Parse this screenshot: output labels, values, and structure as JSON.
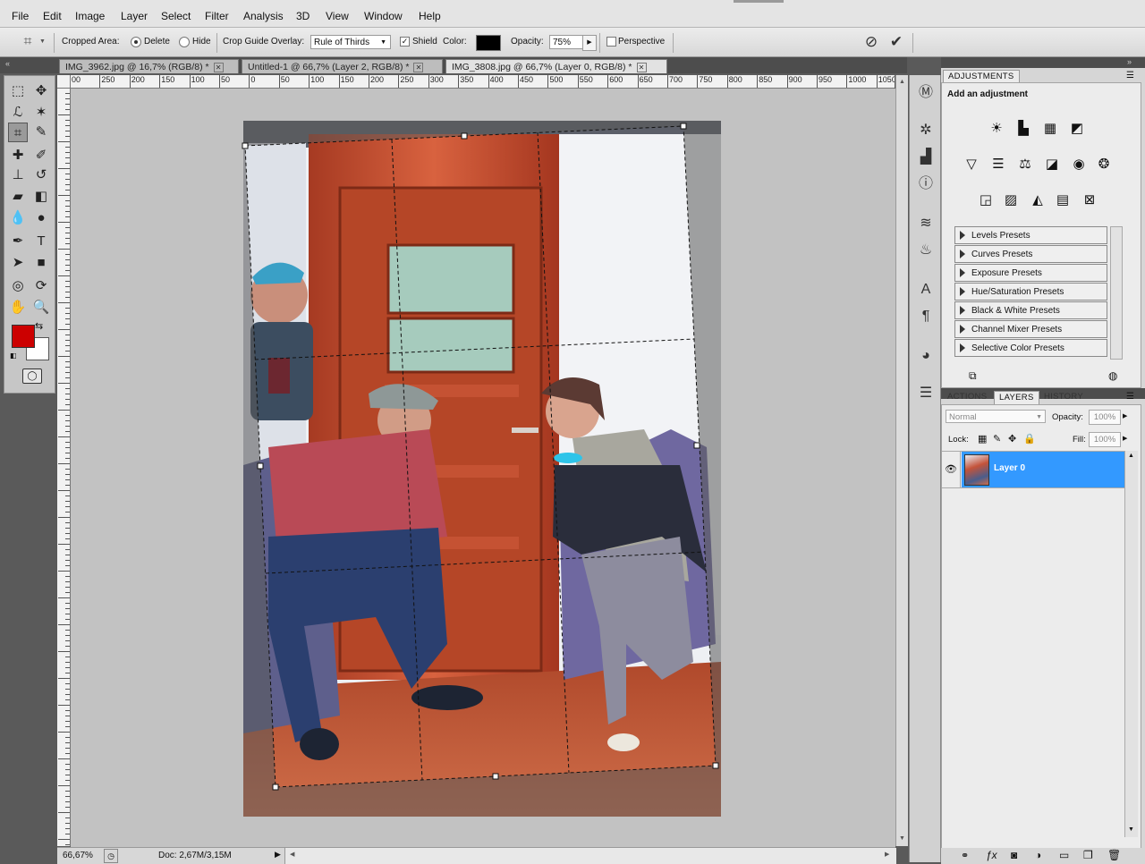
{
  "menu": [
    "File",
    "Edit",
    "Image",
    "Layer",
    "Select",
    "Filter",
    "Analysis",
    "3D",
    "View",
    "Window",
    "Help"
  ],
  "options": {
    "cropped_area_label": "Cropped Area:",
    "delete_label": "Delete",
    "hide_label": "Hide",
    "overlay_label": "Crop Guide Overlay:",
    "overlay_value": "Rule of Thirds",
    "shield_label": "Shield",
    "color_label": "Color:",
    "opacity_label": "Opacity:",
    "opacity_value": "75%",
    "perspective_label": "Perspective"
  },
  "tabs": [
    {
      "label": "IMG_3962.jpg @ 16,7% (RGB/8) *"
    },
    {
      "label": "Untitled-1 @ 66,7% (Layer 2, RGB/8) *"
    },
    {
      "label": "IMG_3808.jpg @ 66,7% (Layer 0, RGB/8) *"
    }
  ],
  "ruler_ticks": [
    "00",
    "250",
    "200",
    "150",
    "100",
    "50",
    "0",
    "50",
    "100",
    "150",
    "200",
    "250",
    "300",
    "350",
    "400",
    "450",
    "500",
    "550",
    "600",
    "650",
    "700",
    "750",
    "800",
    "850",
    "900",
    "950",
    "1000",
    "1050"
  ],
  "status": {
    "zoom": "66,67%",
    "doc": "Doc: 2,67M/3,15M"
  },
  "adjustments": {
    "tab": "ADJUSTMENTS",
    "heading": "Add an adjustment",
    "presets": [
      "Levels Presets",
      "Curves Presets",
      "Exposure Presets",
      "Hue/Saturation Presets",
      "Black & White Presets",
      "Channel Mixer Presets",
      "Selective Color Presets"
    ]
  },
  "layers_panel": {
    "tabs": [
      "ACTIONS",
      "LAYERS",
      "HISTORY"
    ],
    "blend_mode": "Normal",
    "opacity_label": "Opacity:",
    "opacity_value": "100%",
    "lock_label": "Lock:",
    "fill_label": "Fill:",
    "fill_value": "100%",
    "layers": [
      {
        "name": "Layer 0"
      }
    ]
  },
  "colors": {
    "foreground": "#cc0000",
    "background": "#ffffff",
    "shield_color": "#000000",
    "selection": "#3399ff"
  }
}
